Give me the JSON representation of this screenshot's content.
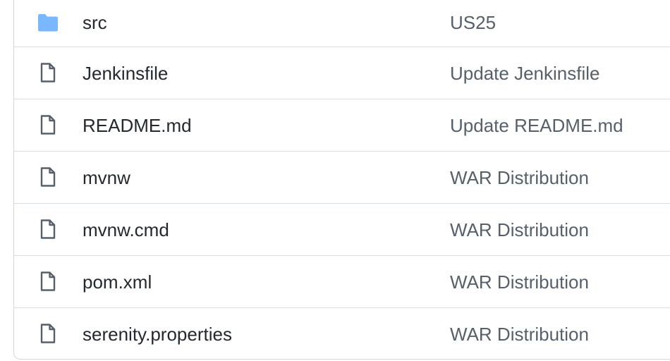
{
  "files": [
    {
      "name": "src",
      "message": "US25",
      "icon": "folder-icon"
    },
    {
      "name": "Jenkinsfile",
      "message": "Update Jenkinsfile",
      "icon": "file-icon"
    },
    {
      "name": "README.md",
      "message": "Update README.md",
      "icon": "file-icon"
    },
    {
      "name": "mvnw",
      "message": "WAR Distribution",
      "icon": "file-icon"
    },
    {
      "name": "mvnw.cmd",
      "message": "WAR Distribution",
      "icon": "file-icon"
    },
    {
      "name": "pom.xml",
      "message": "WAR Distribution",
      "icon": "file-icon"
    },
    {
      "name": "serenity.properties",
      "message": "WAR Distribution",
      "icon": "file-icon"
    }
  ],
  "colors": {
    "folder": "#79b8ff",
    "file_icon": "#57606a",
    "name_text": "#24292f",
    "message_text": "#57606a",
    "border": "#d0d7de"
  }
}
